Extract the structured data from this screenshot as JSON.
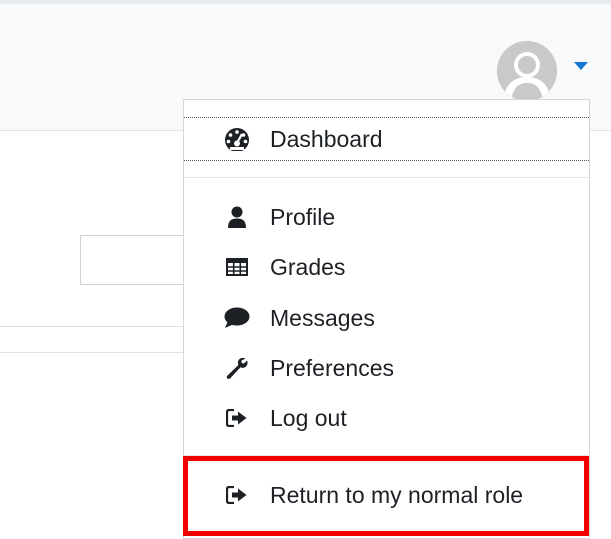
{
  "user_menu": {
    "avatar_icon": "user-avatar-placeholder",
    "caret_icon": "caret-down-icon",
    "items": [
      {
        "label": "Dashboard",
        "icon": "tachometer-icon"
      },
      {
        "label": "Profile",
        "icon": "user-icon"
      },
      {
        "label": "Grades",
        "icon": "table-icon"
      },
      {
        "label": "Messages",
        "icon": "comment-icon"
      },
      {
        "label": "Preferences",
        "icon": "wrench-icon"
      },
      {
        "label": "Log out",
        "icon": "sign-out-icon"
      },
      {
        "label": "Return to my normal role",
        "icon": "sign-out-icon"
      }
    ]
  },
  "colors": {
    "accent": "#1177d1",
    "highlight_border": "#f20000",
    "text": "#1d2125"
  }
}
